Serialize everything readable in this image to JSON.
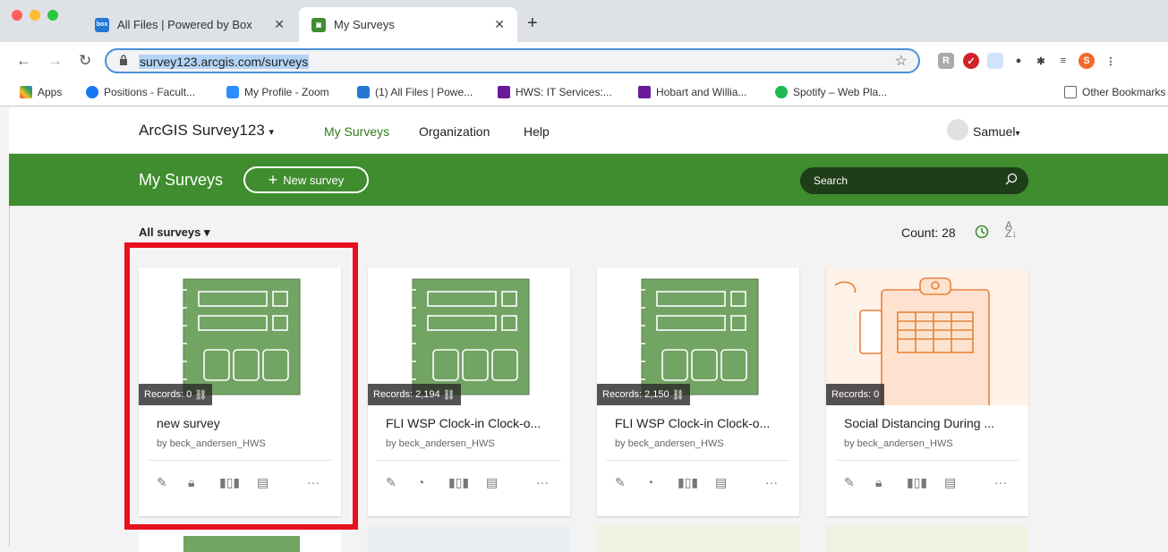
{
  "browser": {
    "tabs": [
      {
        "label": "All Files | Powered by Box",
        "icon": "box-icon"
      },
      {
        "label": "My Surveys",
        "icon": "survey123-icon"
      }
    ],
    "url": "survey123.arcgis.com/surveys",
    "bookmarks": [
      "Apps",
      "Positions - Facult...",
      "My Profile - Zoom",
      "(1) All Files | Powe...",
      "HWS: IT Services:...",
      "Hobart and Willia...",
      "Spotify – Web Pla...",
      "Other Bookmarks"
    ],
    "profile_letter": "S"
  },
  "header": {
    "app_title": "ArcGIS Survey123",
    "nav": [
      "My Surveys",
      "Organization",
      "Help"
    ],
    "user": "Samuel"
  },
  "banner": {
    "title": "My Surveys",
    "new_survey": "New survey",
    "search_placeholder": "Search"
  },
  "filter": {
    "label": "All surveys",
    "count": "Count: 28"
  },
  "cards": [
    {
      "records": "Records: 0",
      "title": "new survey",
      "owner": "by beck_andersen_HWS"
    },
    {
      "records": "Records: 2,194",
      "title": "FLI WSP Clock-in Clock-o...",
      "owner": "by beck_andersen_HWS"
    },
    {
      "records": "Records: 2,150",
      "title": "FLI WSP Clock-in Clock-o...",
      "owner": "by beck_andersen_HWS"
    },
    {
      "records": "Records: 0",
      "title": "Social Distancing During ...",
      "owner": "by beck_andersen_HWS"
    }
  ],
  "colors": {
    "accent": "#3f8d2e",
    "highlight": "#e8101f"
  }
}
